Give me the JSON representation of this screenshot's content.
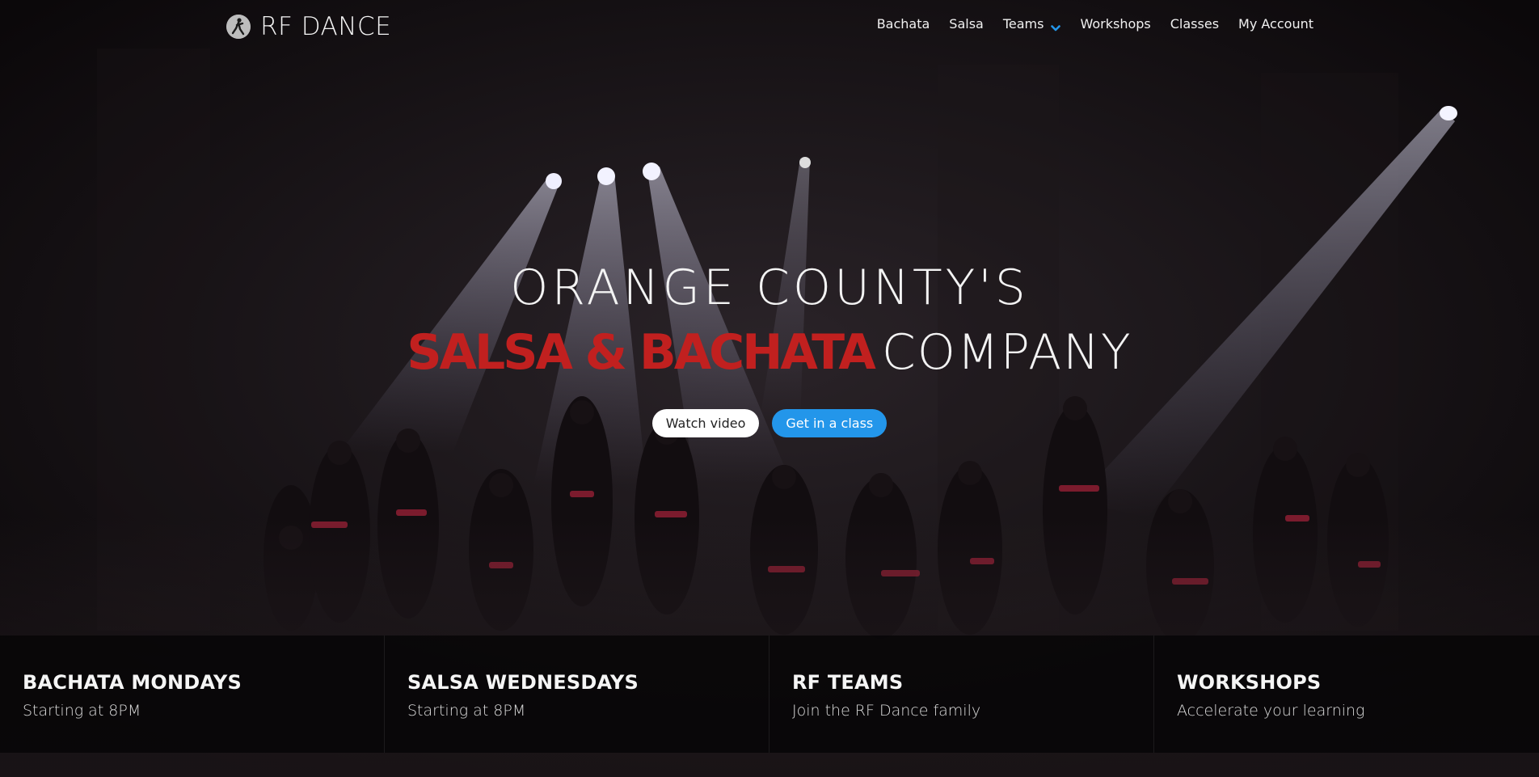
{
  "brand": {
    "name": "RF DANCE",
    "logo_icon": "dancer-silhouette-icon"
  },
  "nav": {
    "items": [
      {
        "label": "Bachata"
      },
      {
        "label": "Salsa"
      },
      {
        "label": "Teams",
        "has_dropdown": true,
        "dropdown_icon": "chevron-down-icon"
      },
      {
        "label": "Workshops"
      },
      {
        "label": "Classes"
      },
      {
        "label": "My Account"
      }
    ],
    "accent_color": "#2396ea"
  },
  "hero": {
    "line1": "ORANGE COUNTY'S",
    "line2_highlight": "SALSA & BACHATA",
    "line2_rest": "COMPANY",
    "highlight_color": "#c1201f",
    "buttons": {
      "watch_video": "Watch video",
      "get_class": "Get in a class"
    }
  },
  "features": [
    {
      "title": "BACHATA MONDAYS",
      "subtitle": "Starting at 8PM"
    },
    {
      "title": "SALSA WEDNESDAYS",
      "subtitle": "Starting at 8PM"
    },
    {
      "title": "RF TEAMS",
      "subtitle": "Join the RF Dance family"
    },
    {
      "title": "WORKSHOPS",
      "subtitle": "Accelerate your learning"
    }
  ]
}
